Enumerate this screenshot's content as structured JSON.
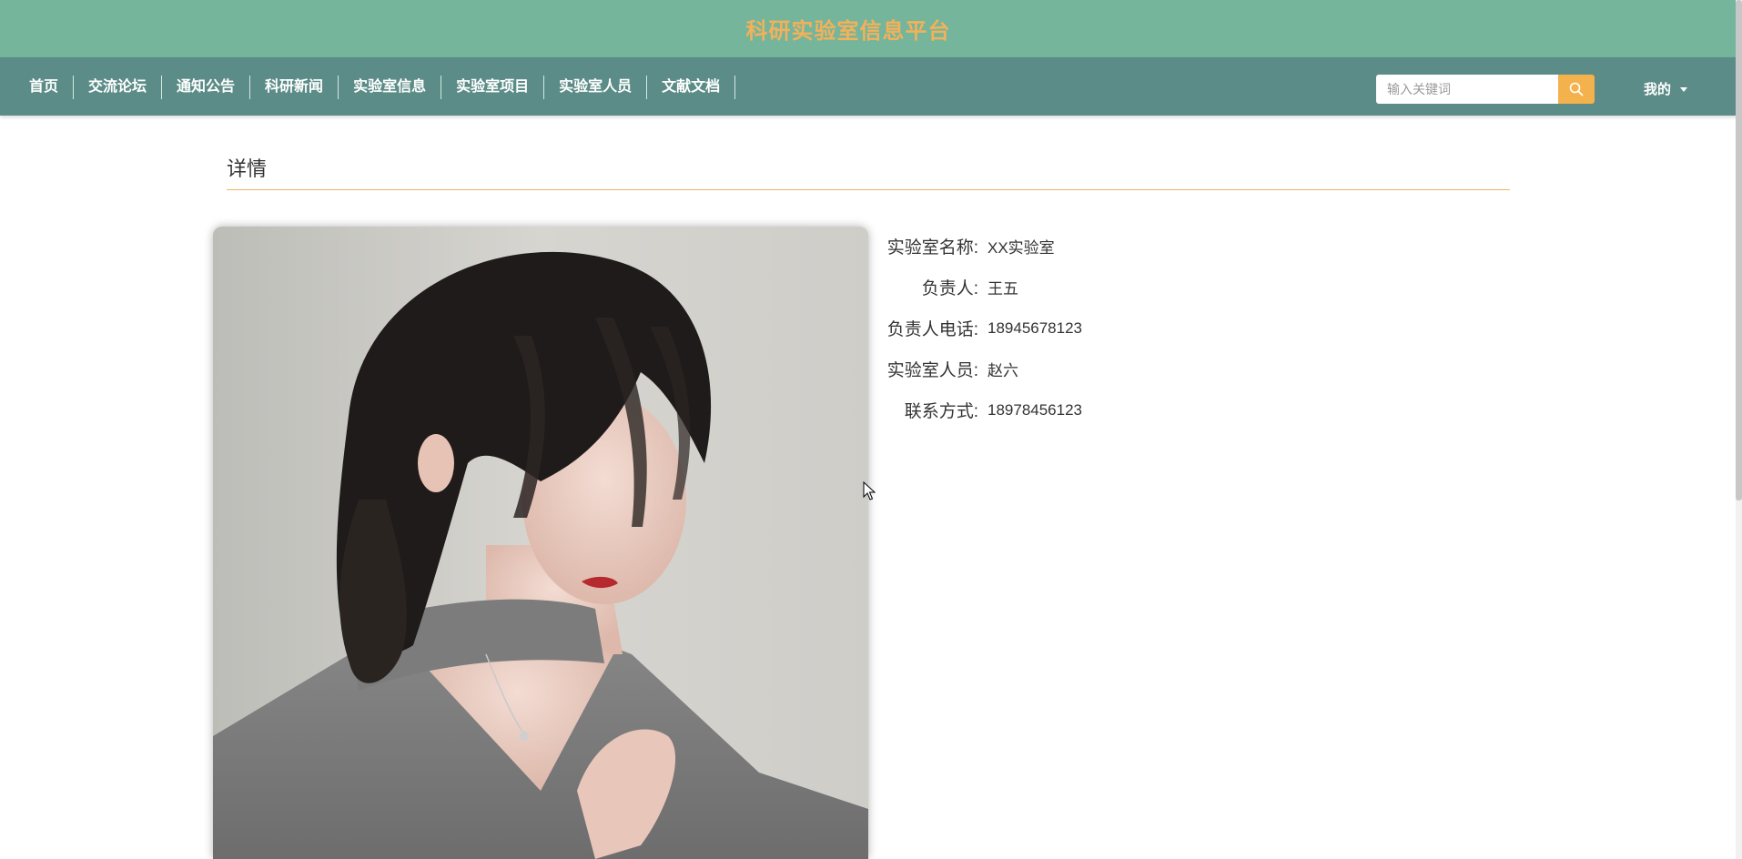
{
  "site": {
    "title": "科研实验室信息平台"
  },
  "nav": {
    "items": [
      {
        "label": "首页",
        "name": "nav-item-home"
      },
      {
        "label": "交流论坛",
        "name": "nav-item-forum"
      },
      {
        "label": "通知公告",
        "name": "nav-item-announcements"
      },
      {
        "label": "科研新闻",
        "name": "nav-item-research-news"
      },
      {
        "label": "实验室信息",
        "name": "nav-item-lab-info"
      },
      {
        "label": "实验室项目",
        "name": "nav-item-lab-projects"
      },
      {
        "label": "实验室人员",
        "name": "nav-item-lab-members"
      },
      {
        "label": "文献文档",
        "name": "nav-item-literature"
      }
    ],
    "search_placeholder": "输入关键词",
    "search_icon": "search-icon",
    "user_menu_label": "我的",
    "user_menu_icon": "caret-down-icon"
  },
  "colors": {
    "title_bar_bg": "#74b59b",
    "nav_bar_bg": "#5b8c87",
    "accent": "#f2b15a",
    "search_button_bg": "#f4b24d",
    "divider": "#f0b56c"
  },
  "detail": {
    "section_title": "详情",
    "fields": [
      {
        "label": "实验室名称:",
        "value": "XX实验室",
        "name": "lab-name"
      },
      {
        "label": "负责人:",
        "value": "王五",
        "name": "lab-leader"
      },
      {
        "label": "负责人电话:",
        "value": "18945678123",
        "name": "lab-leader-phone"
      },
      {
        "label": "实验室人员:",
        "value": "赵六",
        "name": "lab-members"
      },
      {
        "label": "联系方式:",
        "value": "18978456123",
        "name": "lab-contact"
      }
    ]
  }
}
